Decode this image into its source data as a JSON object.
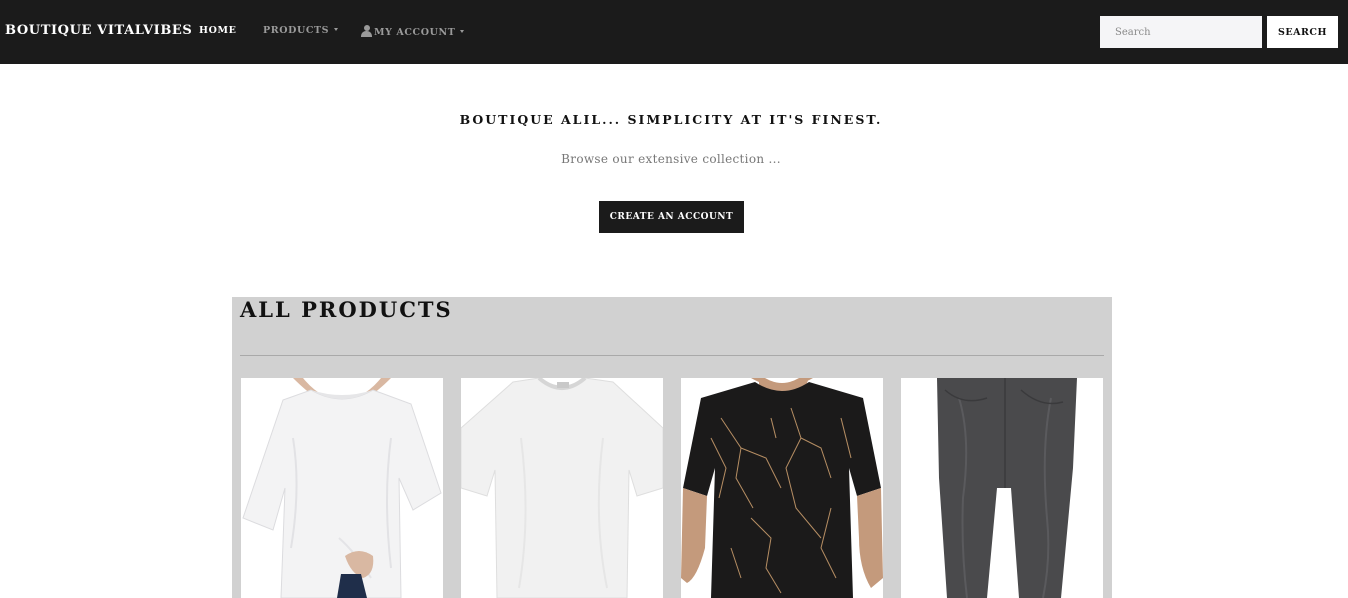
{
  "navbar": {
    "brand": "BOUTIQUE VITALVIBES",
    "items": [
      {
        "label": "HOME",
        "active": true
      },
      {
        "label": "PRODUCTS",
        "dropdown": true
      },
      {
        "label": "MY ACCOUNT",
        "dropdown": true,
        "icon": "user-icon"
      }
    ],
    "search": {
      "placeholder": "Search",
      "value": "",
      "button_label": "SEARCH"
    }
  },
  "hero": {
    "title": "BOUTIQUE ALIL... SIMPLICITY AT IT'S FINEST.",
    "subtitle": "Browse our extensive collection ...",
    "cta_label": "CREATE AN ACCOUNT"
  },
  "products": {
    "heading": "ALL PRODUCTS",
    "items": [
      {
        "image": "white-oversized-tshirt-on-model"
      },
      {
        "image": "white-crew-neck-tshirt"
      },
      {
        "image": "black-marble-print-tshirt-on-model"
      },
      {
        "image": "charcoal-grey-pants"
      }
    ]
  },
  "colors": {
    "navbar_bg": "#1b1b1b",
    "panel_bg": "#d1d1d1",
    "cta_bg": "#1b1b1b"
  }
}
